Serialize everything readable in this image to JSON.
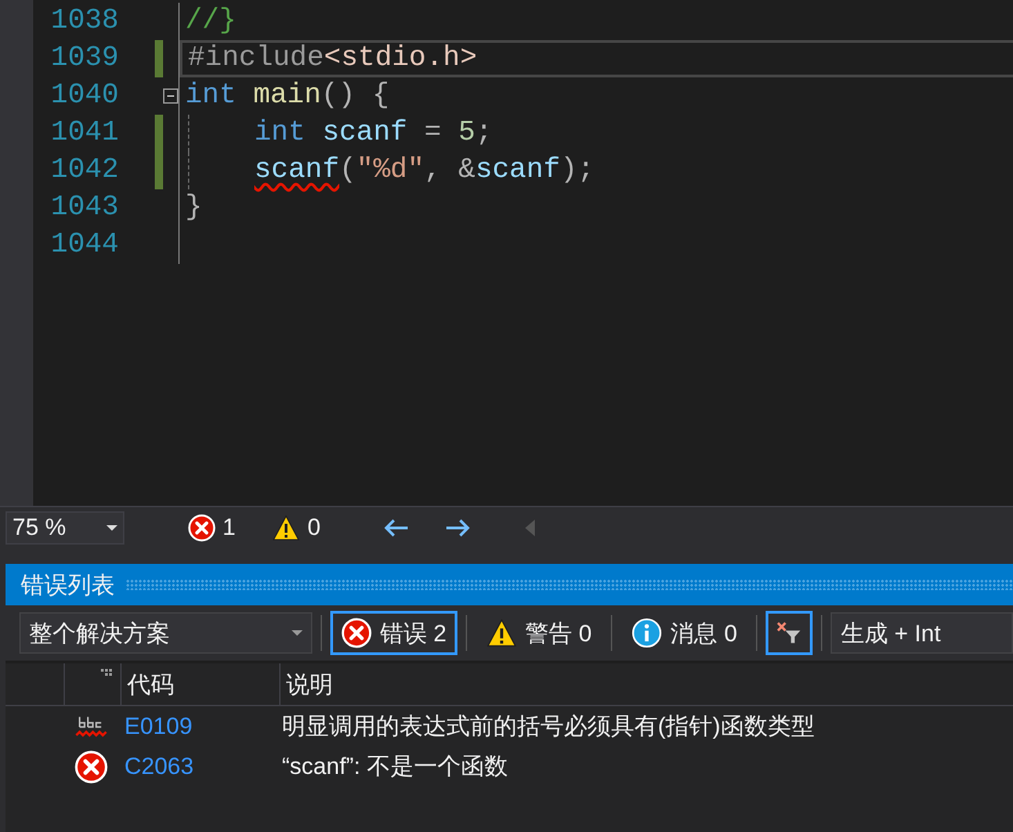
{
  "editor": {
    "lines": [
      {
        "number": "1038",
        "modified": false,
        "current": false,
        "foldable": false,
        "indented": false,
        "tokens": [
          {
            "kind": "comment",
            "text": "//}",
            "error": false
          }
        ]
      },
      {
        "number": "1039",
        "modified": true,
        "current": true,
        "foldable": false,
        "indented": false,
        "tokens": [
          {
            "kind": "preproc",
            "text": "#include",
            "error": false
          },
          {
            "kind": "header",
            "text": "<stdio.h>",
            "error": false
          }
        ]
      },
      {
        "number": "1040",
        "modified": false,
        "current": false,
        "foldable": true,
        "indented": false,
        "tokens": [
          {
            "kind": "keyword",
            "text": "int",
            "error": false
          },
          {
            "kind": "function",
            "text": "main",
            "error": false
          },
          {
            "kind": "punct",
            "text": "() {",
            "error": false
          }
        ]
      },
      {
        "number": "1041",
        "modified": true,
        "current": false,
        "foldable": false,
        "indented": true,
        "tokens": [
          {
            "kind": "keyword",
            "text": "int",
            "error": false
          },
          {
            "kind": "variable",
            "text": "scanf",
            "error": false
          },
          {
            "kind": "punct",
            "text": "=",
            "error": false
          },
          {
            "kind": "number",
            "text": "5",
            "error": false
          },
          {
            "kind": "punct",
            "text": ";",
            "error": false
          }
        ]
      },
      {
        "number": "1042",
        "modified": true,
        "current": false,
        "foldable": false,
        "indented": true,
        "tokens": [
          {
            "kind": "variable",
            "text": "scanf",
            "error": true
          },
          {
            "kind": "punct",
            "text": "(",
            "error": false
          },
          {
            "kind": "string",
            "text": "\"%d\"",
            "error": false
          },
          {
            "kind": "punct",
            "text": ", &",
            "error": false
          },
          {
            "kind": "variable",
            "text": "scanf",
            "error": false
          },
          {
            "kind": "punct",
            "text": ");",
            "error": false
          }
        ]
      },
      {
        "number": "1043",
        "modified": false,
        "current": false,
        "foldable": false,
        "indented": false,
        "tokens": [
          {
            "kind": "punct",
            "text": "}",
            "error": false
          }
        ]
      },
      {
        "number": "1044",
        "modified": false,
        "current": false,
        "foldable": false,
        "indented": false
      }
    ]
  },
  "status_bar": {
    "zoom": "75 %",
    "errors": "1",
    "warnings": "0"
  },
  "error_list": {
    "title": "错误列表",
    "scope": "整个解决方案",
    "filters": [
      {
        "kind": "error",
        "label": "错误 2",
        "selected": true
      },
      {
        "kind": "warning",
        "label": "警告 0",
        "selected": false
      },
      {
        "kind": "info",
        "label": "消息 0",
        "selected": false
      }
    ],
    "filter_toggle": {
      "selected": true
    },
    "build_source": "生成 + Int",
    "columns": [
      "代码",
      "说明"
    ],
    "rows": [
      {
        "kind": "squiggle",
        "code": "E0109",
        "description": "明显调用的表达式前的括号必须具有(指针)函数类型"
      },
      {
        "kind": "error",
        "code": "C2063",
        "description": "“scanf”: 不是一个函数"
      }
    ]
  }
}
